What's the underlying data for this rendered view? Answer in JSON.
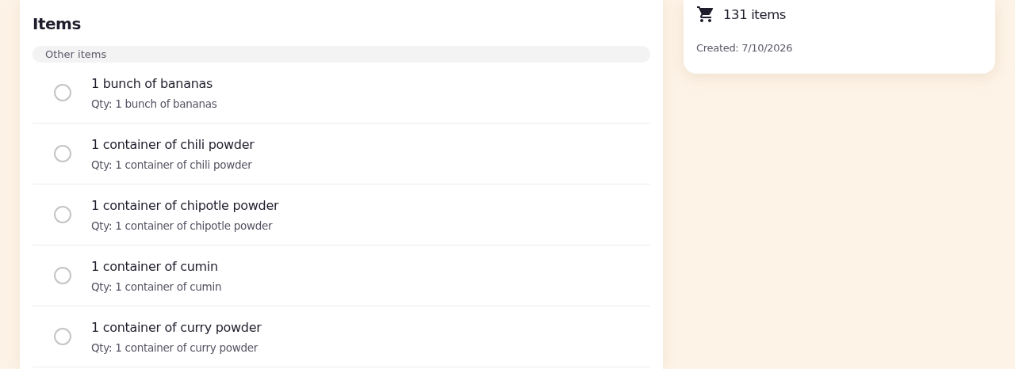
{
  "items_panel": {
    "title": "Items",
    "group": {
      "label": "Other items",
      "items": [
        {
          "name": "1 bunch of bananas",
          "quantity": "Qty: 1 bunch of bananas",
          "checked": false
        },
        {
          "name": "1 container of chili powder",
          "quantity": "Qty: 1 container of chili powder",
          "checked": false
        },
        {
          "name": "1 container of chipotle powder",
          "quantity": "Qty: 1 container of chipotle powder",
          "checked": false
        },
        {
          "name": "1 container of cumin",
          "quantity": "Qty: 1 container of cumin",
          "checked": false
        },
        {
          "name": "1 container of curry powder",
          "quantity": "Qty: 1 container of curry powder",
          "checked": false
        }
      ]
    }
  },
  "summary_card": {
    "item_count": "131 items",
    "created": "Created: 7/10/2026"
  }
}
